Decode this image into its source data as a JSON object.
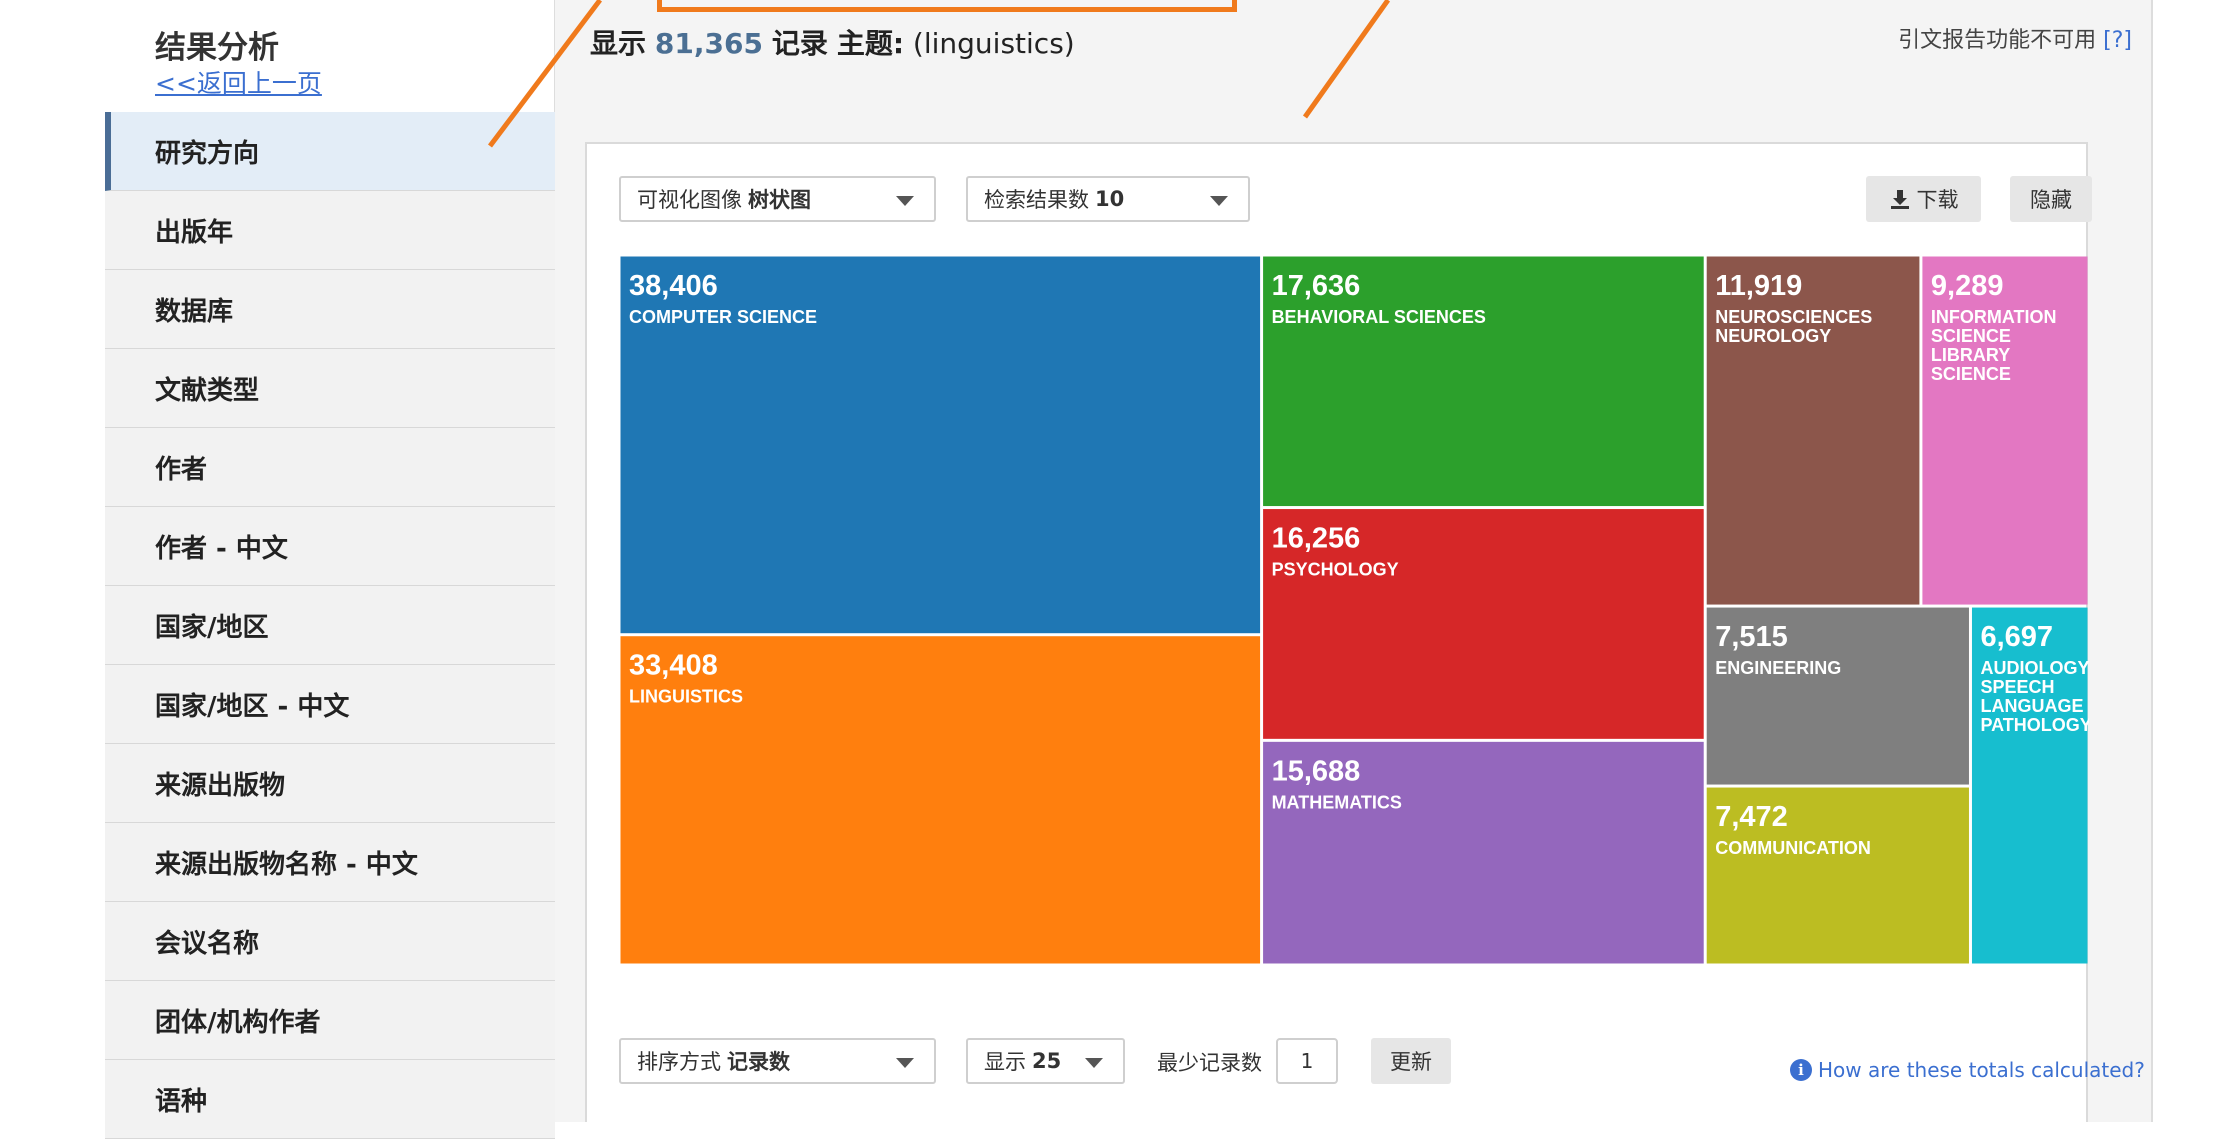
{
  "sidebar": {
    "title": "结果分析",
    "back_link": "<<返回上一页",
    "items": [
      {
        "label": "研究方向"
      },
      {
        "label": "出版年"
      },
      {
        "label": "数据库"
      },
      {
        "label": "文献类型"
      },
      {
        "label": "作者"
      },
      {
        "label": "作者 - 中文"
      },
      {
        "label": "国家/地区"
      },
      {
        "label": "国家/地区 - 中文"
      },
      {
        "label": "来源出版物"
      },
      {
        "label": "来源出版物名称 - 中文"
      },
      {
        "label": "会议名称"
      },
      {
        "label": "团体/机构作者"
      },
      {
        "label": "语种"
      }
    ]
  },
  "header": {
    "prefix": "显示",
    "count": "81,365",
    "records": "记录",
    "topic_label": "主题:",
    "topic_value": "(linguistics)",
    "citation_note": "引文报告功能不可用",
    "citation_help": "[?]"
  },
  "controls": {
    "viz_label": "可视化图像",
    "viz_value": "树状图",
    "results_label": "检索结果数",
    "results_value": "10",
    "download_icon": "download-icon",
    "download_label": "下载",
    "hide_label": "隐藏",
    "sort_label": "排序方式",
    "sort_value": "记录数",
    "show_label": "显示",
    "show_value": "25",
    "min_label": "最少记录数",
    "min_value": "1",
    "update_label": "更新",
    "help_icon": "info-icon",
    "help_link": "How are these totals calculated?"
  },
  "chart_data": {
    "type": "treemap",
    "items": [
      {
        "label": "COMPUTER SCIENCE",
        "value": 38406,
        "value_text": "38,406",
        "color": "#1f77b4"
      },
      {
        "label": "LINGUISTICS",
        "value": 33408,
        "value_text": "33,408",
        "color": "#ff7f0e"
      },
      {
        "label": "BEHAVIORAL SCIENCES",
        "value": 17636,
        "value_text": "17,636",
        "color": "#2ca02c"
      },
      {
        "label": "PSYCHOLOGY",
        "value": 16256,
        "value_text": "16,256",
        "color": "#d62728"
      },
      {
        "label": "MATHEMATICS",
        "value": 15688,
        "value_text": "15,688",
        "color": "#9467bd"
      },
      {
        "label": "NEUROSCIENCES NEUROLOGY",
        "value": 11919,
        "value_text": "11,919",
        "color": "#8c564b"
      },
      {
        "label": "INFORMATION SCIENCE LIBRARY SCIENCE",
        "value": 9289,
        "value_text": "9,289",
        "color": "#e377c2"
      },
      {
        "label": "ENGINEERING",
        "value": 7515,
        "value_text": "7,515",
        "color": "#7f7f7f"
      },
      {
        "label": "COMMUNICATION",
        "value": 7472,
        "value_text": "7,472",
        "color": "#bcbd22"
      },
      {
        "label": "AUDIOLOGY SPEECH LANGUAGE PATHOLOGY",
        "value": 6697,
        "value_text": "6,697",
        "color": "#17becf"
      }
    ]
  }
}
